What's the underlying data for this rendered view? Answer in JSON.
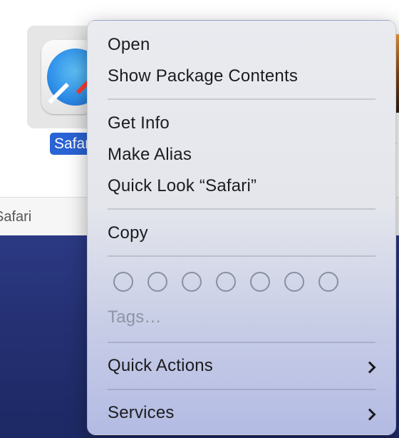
{
  "finder": {
    "selected_app_label": "Safari",
    "path_bar_text": "Safari"
  },
  "context_menu": {
    "items": [
      {
        "label": "Open",
        "enabled": true
      },
      {
        "label": "Show Package Contents",
        "enabled": true
      },
      {
        "label": "Get Info",
        "enabled": true
      },
      {
        "label": "Make Alias",
        "enabled": true
      },
      {
        "label": "Quick Look “Safari”",
        "enabled": true
      },
      {
        "label": "Copy",
        "enabled": true
      },
      {
        "label": "Tags…",
        "enabled": false
      },
      {
        "label": "Quick Actions",
        "enabled": true,
        "submenu": true
      },
      {
        "label": "Services",
        "enabled": true,
        "submenu": true
      }
    ],
    "tag_colors": [
      "none",
      "none",
      "none",
      "none",
      "none",
      "none",
      "none"
    ]
  },
  "icons": {
    "app_icon": "safari-compass-icon",
    "submenu_icon": "chevron-right-icon"
  },
  "colors": {
    "selection_blue": "#2a63d4",
    "desktop": "#243072"
  }
}
